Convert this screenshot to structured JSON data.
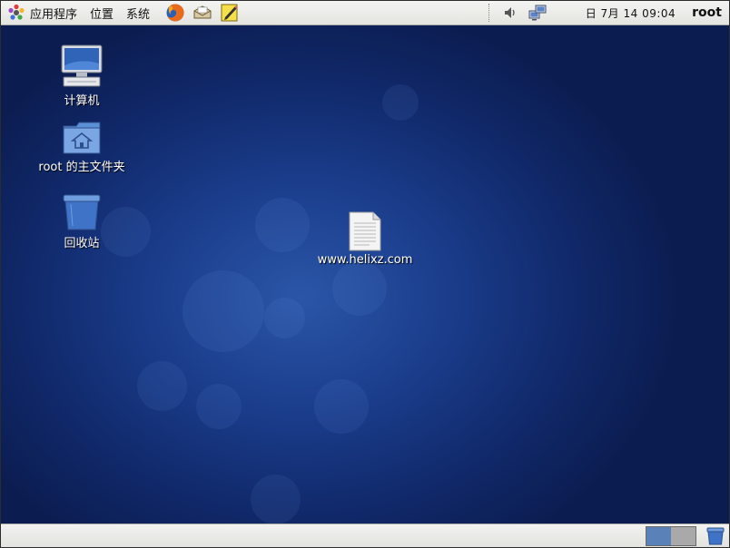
{
  "top_panel": {
    "menus": [
      {
        "label": "应用程序",
        "icon": "gnome-foot-icon"
      },
      {
        "label": "位置"
      },
      {
        "label": "系统"
      }
    ],
    "launchers": [
      {
        "name": "firefox-icon"
      },
      {
        "name": "mail-icon"
      },
      {
        "name": "notes-editor-icon"
      }
    ],
    "tray": [
      {
        "name": "volume-icon"
      },
      {
        "name": "network-icon"
      }
    ],
    "clock": "日 7月 14 09:04",
    "user": "root"
  },
  "desktop": {
    "icons": [
      {
        "label": "计算机",
        "icon": "computer-icon"
      },
      {
        "label": "root 的主文件夹",
        "icon": "home-folder-icon"
      },
      {
        "label": "回收站",
        "icon": "trash-icon"
      },
      {
        "label": "www.helixz.com",
        "icon": "text-file-icon"
      }
    ]
  },
  "bottom_panel": {
    "workspaces": 2,
    "active_workspace": 1
  },
  "colors": {
    "desktop_bg": "#1a3c8a",
    "panel_bg": "#e8e8e4",
    "workspace_active": "#5a82b8"
  }
}
